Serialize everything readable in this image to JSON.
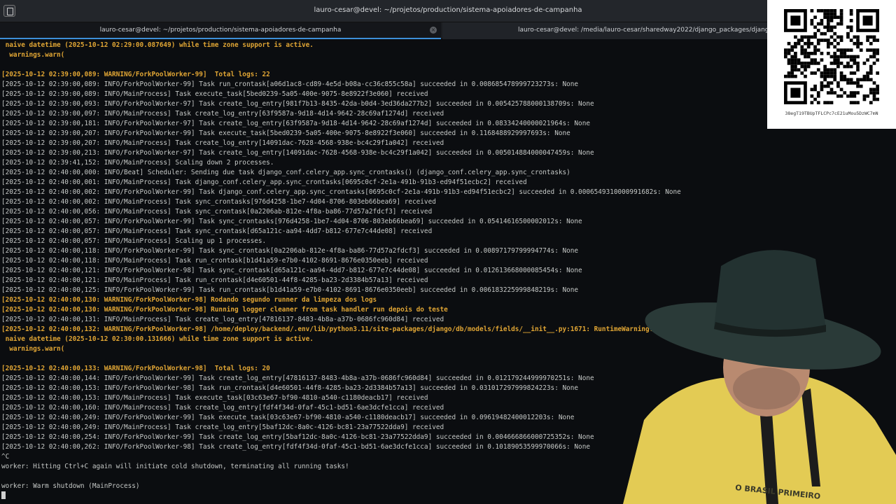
{
  "window": {
    "title": "lauro-cesar@devel: ~/projetos/production/sistema-apoiadores-de-campanha"
  },
  "tabs": [
    {
      "label": "lauro-cesar@devel: ~/projetos/production/sistema-apoiadores-de-campanha",
      "active": true
    },
    {
      "label": "lauro-cesar@devel: /media/lauro-cesar/sharedway2022/django_packages/django_temp",
      "active": false
    }
  ],
  "terminal": {
    "lines": [
      {
        "text": " naive datetime (2025-10-12 02:29:00.087649) while time zone support is active.",
        "level": "warn"
      },
      {
        "text": "  warnings.warn(",
        "level": "warn"
      },
      {
        "text": "",
        "level": "info"
      },
      {
        "text": "[2025-10-12 02:39:00,089: WARNING/ForkPoolWorker-99]  Total logs: 22",
        "level": "warn"
      },
      {
        "text": "[2025-10-12 02:39:00,089: INFO/ForkPoolWorker-99] Task run_crontask[a06d1ac8-cd89-4e5d-b08a-cc36c855c58a] succeeded in 0.008685478999723273s: None",
        "level": "info"
      },
      {
        "text": "[2025-10-12 02:39:00,089: INFO/MainProcess] Task execute_task[5bed0239-5a05-400e-9075-8e8922f3e060] received",
        "level": "info"
      },
      {
        "text": "[2025-10-12 02:39:00,093: INFO/ForkPoolWorker-97] Task create_log_entry[981f7b13-8435-42da-b0d4-3ed36da277b2] succeeded in 0.005425788000138709s: None",
        "level": "info"
      },
      {
        "text": "[2025-10-12 02:39:00,097: INFO/MainProcess] Task create_log_entry[63f9587a-9d18-4d14-9642-28c69af1274d] received",
        "level": "info"
      },
      {
        "text": "[2025-10-12 02:39:00,181: INFO/ForkPoolWorker-97] Task create_log_entry[63f9587a-9d18-4d14-9642-28c69af1274d] succeeded in 0.08334240000021964s: None",
        "level": "info"
      },
      {
        "text": "[2025-10-12 02:39:00,207: INFO/ForkPoolWorker-99] Task execute_task[5bed0239-5a05-400e-9075-8e8922f3e060] succeeded in 0.1168488929997693s: None",
        "level": "info"
      },
      {
        "text": "[2025-10-12 02:39:00,207: INFO/MainProcess] Task create_log_entry[14091dac-7628-4568-938e-bc4c29f1a042] received",
        "level": "info"
      },
      {
        "text": "[2025-10-12 02:39:00,213: INFO/ForkPoolWorker-97] Task create_log_entry[14091dac-7628-4568-938e-bc4c29f1a042] succeeded in 0.005014884000047459s: None",
        "level": "info"
      },
      {
        "text": "[2025-10-12 02:39:41,152: INFO/MainProcess] Scaling down 2 processes.",
        "level": "info"
      },
      {
        "text": "[2025-10-12 02:40:00,000: INFO/Beat] Scheduler: Sending due task django_conf.celery_app.sync_crontasks() (django_conf.celery_app.sync_crontasks)",
        "level": "info"
      },
      {
        "text": "[2025-10-12 02:40:00,001: INFO/MainProcess] Task django_conf.celery_app.sync_crontasks[0695c0cf-2e1a-491b-91b3-ed94f51ecbc2] received",
        "level": "info"
      },
      {
        "text": "[2025-10-12 02:40:00,002: INFO/ForkPoolWorker-99] Task django_conf.celery_app.sync_crontasks[0695c0cf-2e1a-491b-91b3-ed94f51ecbc2] succeeded in 0.0006549310000991682s: None",
        "level": "info"
      },
      {
        "text": "[2025-10-12 02:40:00,002: INFO/MainProcess] Task sync_crontasks[976d4258-1be7-4d04-8706-803eb66bea69] received",
        "level": "info"
      },
      {
        "text": "[2025-10-12 02:40:00,056: INFO/MainProcess] Task sync_crontask[0a2206ab-812e-4f8a-ba86-77d57a2fdcf3] received",
        "level": "info"
      },
      {
        "text": "[2025-10-12 02:40:00,057: INFO/ForkPoolWorker-99] Task sync_crontasks[976d4258-1be7-4d04-8706-803eb66bea69] succeeded in 0.05414616500002012s: None",
        "level": "info"
      },
      {
        "text": "[2025-10-12 02:40:00,057: INFO/MainProcess] Task sync_crontask[d65a121c-aa94-4dd7-b812-677e7c44de08] received",
        "level": "info"
      },
      {
        "text": "[2025-10-12 02:40:00,057: INFO/MainProcess] Scaling up 1 processes.",
        "level": "info"
      },
      {
        "text": "[2025-10-12 02:40:00,118: INFO/ForkPoolWorker-99] Task sync_crontask[0a2206ab-812e-4f8a-ba86-77d57a2fdcf3] succeeded in 0.00897179799994774s: None",
        "level": "info"
      },
      {
        "text": "[2025-10-12 02:40:00,118: INFO/MainProcess] Task run_crontask[b1d41a59-e7b0-4102-8691-8676e0350eeb] received",
        "level": "info"
      },
      {
        "text": "[2025-10-12 02:40:00,121: INFO/ForkPoolWorker-98] Task sync_crontask[d65a121c-aa94-4dd7-b812-677e7c44de08] succeeded in 0.012613668000085454s: None",
        "level": "info"
      },
      {
        "text": "[2025-10-12 02:40:00,121: INFO/MainProcess] Task run_crontask[d4e60501-44f8-4285-ba23-2d3384b57a13] received",
        "level": "info"
      },
      {
        "text": "[2025-10-12 02:40:00,125: INFO/ForkPoolWorker-99] Task run_crontask[b1d41a59-e7b0-4102-8691-8676e0350eeb] succeeded in 0.006183225999848219s: None",
        "level": "info"
      },
      {
        "text": "[2025-10-12 02:40:00,130: WARNING/ForkPoolWorker-98] Rodando segundo runner da limpeza dos logs",
        "level": "warn"
      },
      {
        "text": "[2025-10-12 02:40:00,130: WARNING/ForkPoolWorker-98] Running logger cleaner from task handler run depois do teste",
        "level": "warn"
      },
      {
        "text": "[2025-10-12 02:40:00,131: INFO/MainProcess] Task create_log_entry[47816137-8483-4b8a-a37b-0686fc960d84] received",
        "level": "info"
      },
      {
        "text": "[2025-10-12 02:40:00,132: WARNING/ForkPoolWorker-98] /home/deploy/backend/.env/lib/python3.11/site-packages/django/db/models/fields/__init__.py:1671: RuntimeWarning: D",
        "level": "warn"
      },
      {
        "text": " naive datetime (2025-10-12 02:30:00.131666) while time zone support is active.",
        "level": "warn"
      },
      {
        "text": "  warnings.warn(",
        "level": "warn"
      },
      {
        "text": "",
        "level": "info"
      },
      {
        "text": "[2025-10-12 02:40:00,133: WARNING/ForkPoolWorker-98]  Total logs: 20",
        "level": "warn"
      },
      {
        "text": "[2025-10-12 02:40:00,144: INFO/ForkPoolWorker-99] Task create_log_entry[47816137-8483-4b8a-a37b-0686fc960d84] succeeded in 0.012179244999970251s: None",
        "level": "info"
      },
      {
        "text": "[2025-10-12 02:40:00,153: INFO/ForkPoolWorker-98] Task run_crontask[d4e60501-44f8-4285-ba23-2d3384b57a13] succeeded in 0.031017297999824223s: None",
        "level": "info"
      },
      {
        "text": "[2025-10-12 02:40:00,153: INFO/MainProcess] Task execute_task[03c63e67-bf90-4810-a540-c1180deacb17] received",
        "level": "info"
      },
      {
        "text": "[2025-10-12 02:40:00,160: INFO/MainProcess] Task create_log_entry[fdf4f34d-0faf-45c1-bd51-6ae3dcfe1cca] received",
        "level": "info"
      },
      {
        "text": "[2025-10-12 02:40:00,249: INFO/ForkPoolWorker-99] Task execute_task[03c63e67-bf90-4810-a540-c1180deacb17] succeeded in 0.09619482400012203s: None",
        "level": "info"
      },
      {
        "text": "[2025-10-12 02:40:00,249: INFO/MainProcess] Task create_log_entry[5baf12dc-8a0c-4126-bc81-23a77522dda9] received",
        "level": "info"
      },
      {
        "text": "[2025-10-12 02:40:00,254: INFO/ForkPoolWorker-99] Task create_log_entry[5baf12dc-8a0c-4126-bc81-23a77522dda9] succeeded in 0.004666866000725352s: None",
        "level": "info"
      },
      {
        "text": "[2025-10-12 02:40:00,262: INFO/ForkPoolWorker-98] Task create_log_entry[fdf4f34d-0faf-45c1-bd51-6ae3dcfe1cca] succeeded in 0.10189053599970066s: None",
        "level": "info"
      },
      {
        "text": "^C",
        "level": "info"
      },
      {
        "text": "worker: Hitting Ctrl+C again will initiate cold shutdown, terminating all running tasks!",
        "level": "info"
      },
      {
        "text": "",
        "level": "info"
      },
      {
        "text": "worker: Warm shutdown (MainProcess)",
        "level": "info"
      }
    ]
  },
  "qr": {
    "caption": "38egT19TBUpTFLCPc7cE21uMou5DzWC7mN"
  },
  "colors": {
    "terminal_bg": "#0b0d10",
    "text_info": "#c5c8c6",
    "text_warning": "#e0a534",
    "tab_accent": "#3d8fd8"
  },
  "icons": {
    "app": "terminal-app-icon",
    "tab_close": "close-icon"
  }
}
